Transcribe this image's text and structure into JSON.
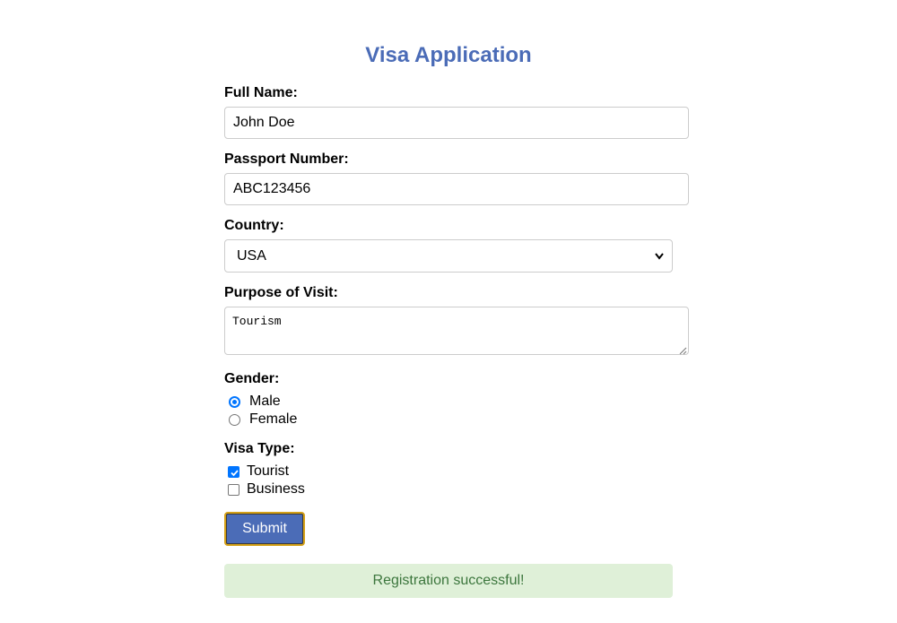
{
  "form": {
    "title": "Visa Application",
    "full_name": {
      "label": "Full Name:",
      "value": "John Doe"
    },
    "passport_number": {
      "label": "Passport Number:",
      "value": "ABC123456"
    },
    "country": {
      "label": "Country:",
      "selected": "USA"
    },
    "purpose": {
      "label": "Purpose of Visit:",
      "value": "Tourism"
    },
    "gender": {
      "label": "Gender:",
      "options": [
        {
          "label": "Male",
          "checked": true
        },
        {
          "label": "Female",
          "checked": false
        }
      ]
    },
    "visa_type": {
      "label": "Visa Type:",
      "options": [
        {
          "label": "Tourist",
          "checked": true
        },
        {
          "label": "Business",
          "checked": false
        }
      ]
    },
    "submit_label": "Submit",
    "status_message": "Registration successful!"
  },
  "colors": {
    "accent": "#4b6cb7",
    "success_bg": "#dff0d8",
    "success_text": "#3c763d",
    "control_blue": "#0075ff",
    "focus_border": "#d4a017"
  },
  "icons": {
    "select_arrow": "chevron-down-icon",
    "textarea_grip": "resize-grip-icon",
    "checkmark": "checkmark-icon"
  }
}
